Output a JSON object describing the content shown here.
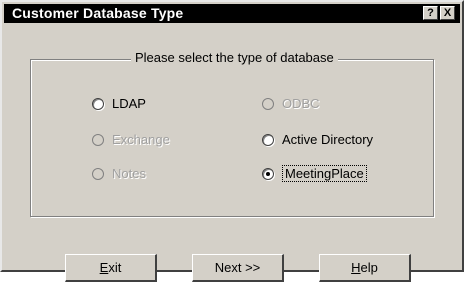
{
  "window": {
    "title": "Customer Database Type",
    "help_button": "?",
    "close_button": "X"
  },
  "group": {
    "legend": "Please select the type of database"
  },
  "options": {
    "ldap": {
      "label": "LDAP",
      "enabled": true,
      "selected": false
    },
    "odbc": {
      "label": "ODBC",
      "enabled": false,
      "selected": false
    },
    "exchange": {
      "label": "Exchange",
      "enabled": false,
      "selected": false
    },
    "active_directory": {
      "label": "Active Directory",
      "enabled": true,
      "selected": false
    },
    "notes": {
      "label": "Notes",
      "enabled": false,
      "selected": false
    },
    "meetingplace": {
      "label": "MeetingPlace",
      "enabled": true,
      "selected": true
    }
  },
  "buttons": {
    "exit": {
      "mnemonic": "E",
      "rest": "xit"
    },
    "next": {
      "label": "Next >>"
    },
    "help": {
      "mnemonic": "H",
      "rest": "elp"
    }
  }
}
